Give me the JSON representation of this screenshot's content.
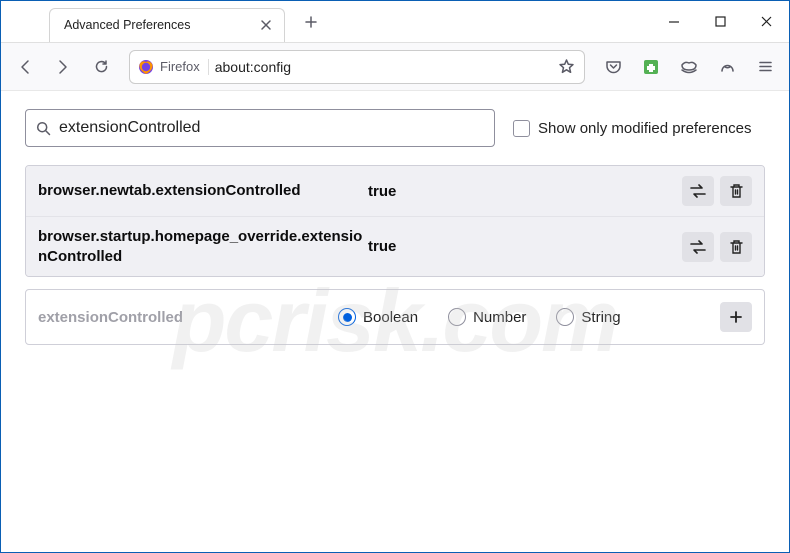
{
  "window": {
    "tab_title": "Advanced Preferences",
    "identity_label": "Firefox",
    "url": "about:config"
  },
  "config": {
    "search_value": "extensionControlled",
    "show_modified_label": "Show only modified preferences",
    "rows": [
      {
        "name": "browser.newtab.extensionControlled",
        "value": "true"
      },
      {
        "name": "browser.startup.homepage_override.extensionControlled",
        "value": "true"
      }
    ],
    "new_pref": {
      "name": "extensionControlled",
      "types": [
        "Boolean",
        "Number",
        "String"
      ],
      "selected": "Boolean"
    }
  },
  "icons": {
    "close": "close-icon",
    "plus": "plus-icon",
    "minimize": "minimize-icon",
    "maximize": "maximize-icon",
    "window_close": "window-close-icon",
    "back": "back-icon",
    "forward": "forward-icon",
    "reload": "reload-icon",
    "star": "star-icon",
    "pocket": "pocket-icon",
    "extension": "extension-icon",
    "mask": "mask-icon",
    "shield": "shield-icon",
    "menu": "menu-icon",
    "search": "search-icon",
    "toggle": "toggle-icon",
    "delete": "delete-icon",
    "add": "add-icon"
  },
  "watermark": "pcrisk.com"
}
